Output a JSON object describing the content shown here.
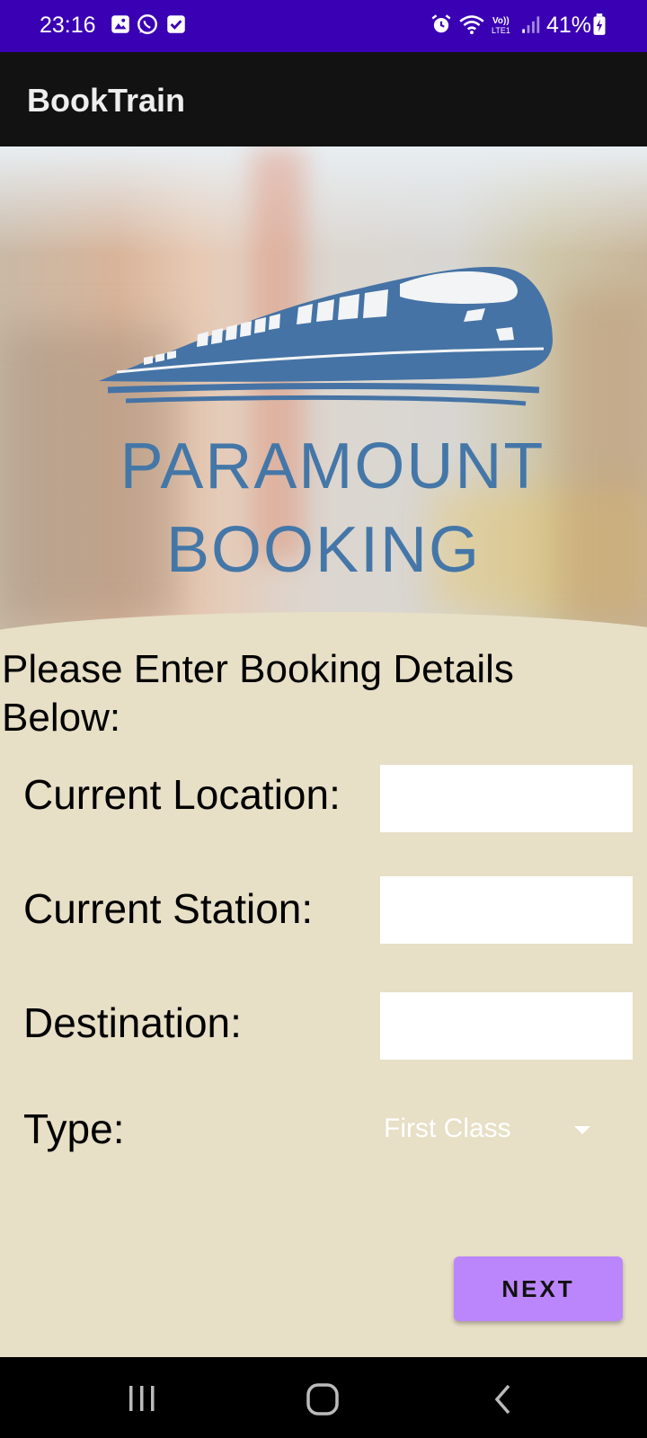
{
  "status_bar": {
    "time": "23:16",
    "battery": "41%",
    "icons": [
      "gallery-icon",
      "whatsapp-icon",
      "checkbox-icon",
      "alarm-icon",
      "wifi-icon",
      "volte-icon",
      "signal-icon",
      "battery-icon"
    ]
  },
  "app_bar": {
    "title": "BookTrain"
  },
  "hero": {
    "logo_line1": "PARAMOUNT",
    "logo_line2": "BOOKING",
    "logo_color": "#4477a8"
  },
  "form": {
    "prompt": "Please Enter Booking Details Below:",
    "current_location": {
      "label": "Current Location:",
      "value": ""
    },
    "current_station": {
      "label": "Current Station:",
      "value": ""
    },
    "destination": {
      "label": "Destination:",
      "value": ""
    },
    "type": {
      "label": "Type:",
      "selected": "First Class"
    },
    "next_button": "NEXT"
  },
  "colors": {
    "status_bar": "#3a00b4",
    "app_bar": "#121212",
    "background": "#e7dfc6",
    "button": "#bb86fc"
  },
  "nav_bar": {
    "icons": [
      "recent-apps-icon",
      "home-icon",
      "back-icon"
    ]
  }
}
